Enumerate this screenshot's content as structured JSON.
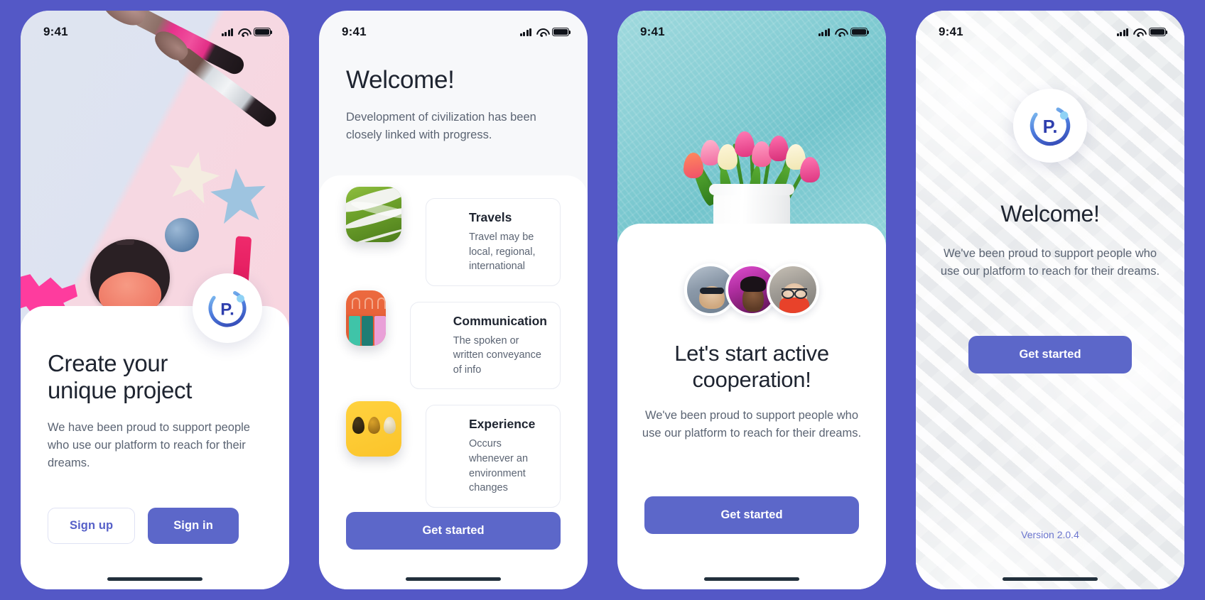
{
  "theme": {
    "background": "#5458c6",
    "primary": "#5c67c9",
    "card": "#ffffff",
    "heading": "#1e2430",
    "body_text": "#5b6473",
    "version_text": "#6c76cf"
  },
  "status_bar": {
    "time": "9:41",
    "icons": [
      "signal-icon",
      "wifi-icon",
      "battery-icon"
    ]
  },
  "screens": [
    {
      "id": "create-project",
      "hero": "cosmetics-flatlay-photo",
      "logo_alt": "P. brand logo",
      "title": "Create your\nunique project",
      "title_line1": "Create your",
      "title_line2": "unique project",
      "subtitle": "We have been proud to support people who use our platform to reach for their dreams.",
      "buttons": [
        {
          "label": "Sign up",
          "style": "outline"
        },
        {
          "label": "Sign in",
          "style": "solid"
        }
      ]
    },
    {
      "id": "welcome-features",
      "title": "Welcome!",
      "subtitle": "Development of civilization has been closely linked with progress.",
      "features": [
        {
          "icon": "travels-thumbnail",
          "title": "Travels",
          "desc": "Travel may be local, regional, international"
        },
        {
          "icon": "communication-thumbnail",
          "title": "Communication",
          "desc": "The spoken or written conveyance of info"
        },
        {
          "icon": "experience-thumbnail",
          "title": "Experience",
          "desc": "Occurs whenever an environment changes"
        }
      ],
      "cta": "Get started"
    },
    {
      "id": "active-cooperation",
      "hero": "tulips-in-vase-photo",
      "avatars": [
        "avatar-man-sunglasses",
        "avatar-man-purple",
        "avatar-woman-glasses"
      ],
      "title_line1": "Let's start active",
      "title_line2": "cooperation!",
      "subtitle": "We've been proud to support people who use our platform to reach for their dreams.",
      "cta": "Get started"
    },
    {
      "id": "welcome-final",
      "logo_alt": "P. brand logo",
      "title": "Welcome!",
      "subtitle": "We've been proud to support people who use our platform to reach for their dreams.",
      "cta": "Get started",
      "version": "Version 2.0.4"
    }
  ]
}
